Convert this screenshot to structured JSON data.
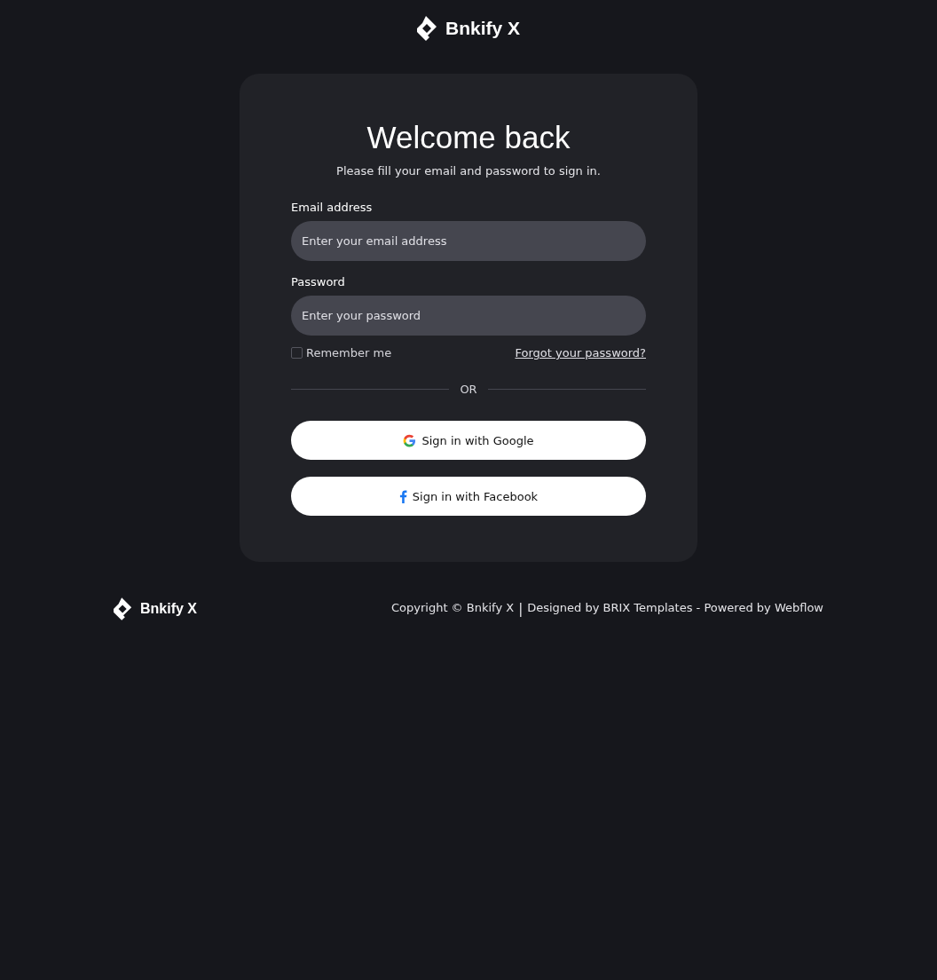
{
  "header": {
    "brand": "Bnkify X"
  },
  "card": {
    "title": "Welcome back",
    "subtitle": "Please fill your email and password to sign in.",
    "fields": [
      {
        "label": "Email address",
        "placeholder": "Enter your email address"
      },
      {
        "label": "Password",
        "placeholder": "Enter your password"
      }
    ],
    "remember": {
      "label": "Remember me",
      "checked": false
    },
    "forgot_link": "Forgot your password?",
    "divider": "OR",
    "social_buttons": [
      {
        "kind": "google",
        "label": "Sign in with Google"
      },
      {
        "kind": "facebook",
        "label": "Sign in with Facebook"
      }
    ]
  },
  "footer": {
    "brand": "Bnkify X",
    "copyright": "Copyright © Bnkify X",
    "separator": "|",
    "credits": "Designed by BRIX Templates - Powered by Webflow"
  }
}
